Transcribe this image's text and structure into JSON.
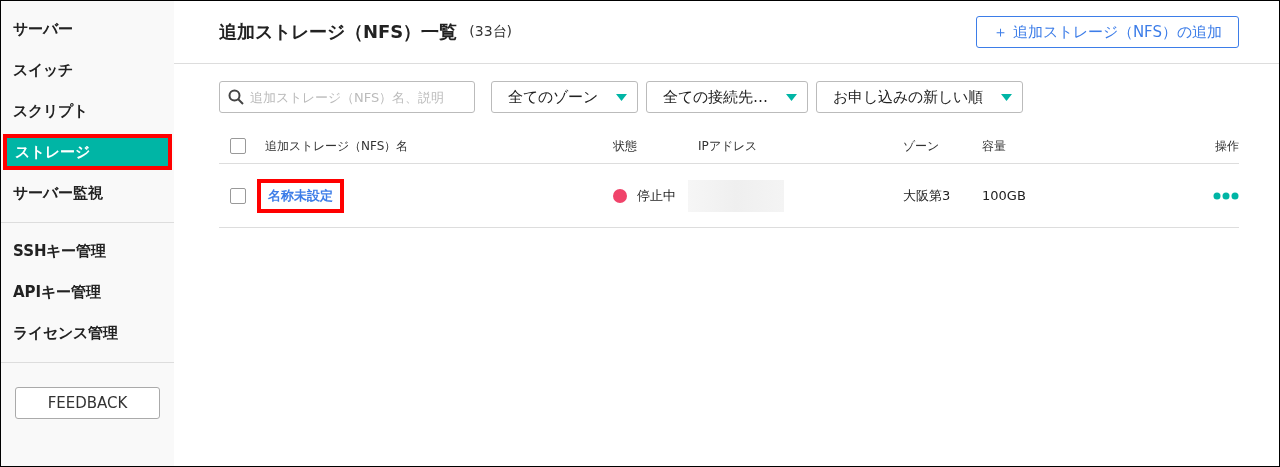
{
  "sidebar": {
    "groups": [
      {
        "items": [
          {
            "label": "サーバー",
            "selected": false,
            "highlighted": false
          },
          {
            "label": "スイッチ",
            "selected": false,
            "highlighted": false
          },
          {
            "label": "スクリプト",
            "selected": false,
            "highlighted": false
          },
          {
            "label": "ストレージ",
            "selected": true,
            "highlighted": true
          },
          {
            "label": "サーバー監視",
            "selected": false,
            "highlighted": false
          }
        ]
      },
      {
        "items": [
          {
            "label": "SSHキー管理",
            "selected": false,
            "highlighted": false
          },
          {
            "label": "APIキー管理",
            "selected": false,
            "highlighted": false
          },
          {
            "label": "ライセンス管理",
            "selected": false,
            "highlighted": false
          }
        ]
      }
    ],
    "feedback_button": "FEEDBACK"
  },
  "header": {
    "title": "追加ストレージ（NFS）一覧",
    "count": "(33台)",
    "add_button": "＋ 追加ストレージ（NFS）の追加"
  },
  "filters": {
    "search": {
      "placeholder": "追加ストレージ（NFS）名、説明"
    },
    "dropdowns": [
      "全てのゾーン",
      "全ての接続先…",
      "お申し込みの新しい順"
    ]
  },
  "table": {
    "select_all_checked": false,
    "columns": [
      "追加ストレージ（NFS）名",
      "状態",
      "IPアドレス",
      "ゾーン",
      "容量",
      "操作"
    ],
    "rows": [
      {
        "checked": false,
        "name": "名称未設定",
        "highlighted": true,
        "status": "停止中",
        "color": "#f0436a",
        "ip": {
          "kind": "redacted"
        },
        "zone": "大阪第3",
        "capacity": "100GB"
      }
    ]
  }
}
